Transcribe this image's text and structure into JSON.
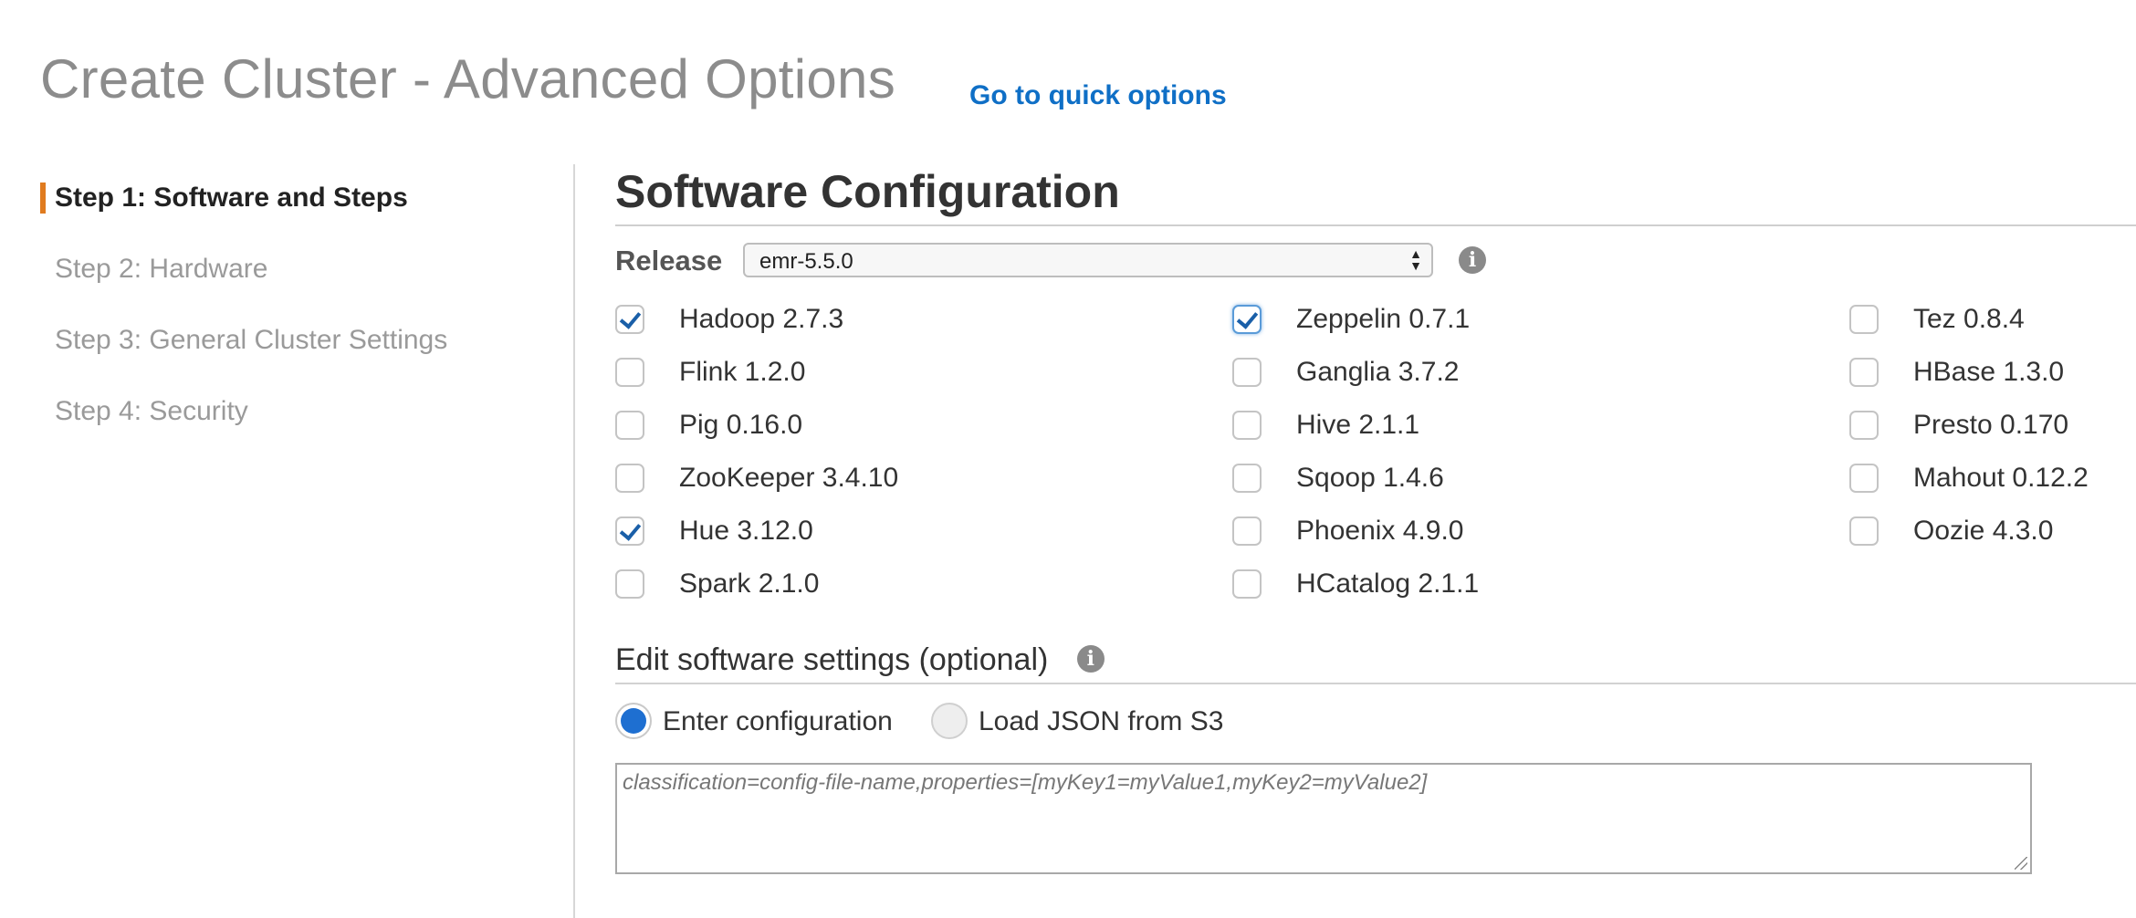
{
  "page": {
    "title": "Create Cluster - Advanced Options",
    "quick_options_link": "Go to quick options"
  },
  "sidebar": {
    "items": [
      {
        "label": "Step 1: Software and Steps",
        "active": true
      },
      {
        "label": "Step 2: Hardware",
        "active": false
      },
      {
        "label": "Step 3: General Cluster Settings",
        "active": false
      },
      {
        "label": "Step 4: Security",
        "active": false
      }
    ]
  },
  "software": {
    "title": "Software Configuration",
    "release_label": "Release",
    "release_value": "emr-5.5.0",
    "info_icon": "info-icon",
    "applications": [
      {
        "label": "Hadoop 2.7.3",
        "checked": true
      },
      {
        "label": "Flink 1.2.0",
        "checked": false
      },
      {
        "label": "Pig 0.16.0",
        "checked": false
      },
      {
        "label": "ZooKeeper 3.4.10",
        "checked": false
      },
      {
        "label": "Hue 3.12.0",
        "checked": true
      },
      {
        "label": "Spark 2.1.0",
        "checked": false
      },
      {
        "label": "Zeppelin 0.7.1",
        "checked": true
      },
      {
        "label": "Ganglia 3.7.2",
        "checked": false
      },
      {
        "label": "Hive 2.1.1",
        "checked": false
      },
      {
        "label": "Sqoop 1.4.6",
        "checked": false
      },
      {
        "label": "Phoenix 4.9.0",
        "checked": false
      },
      {
        "label": "HCatalog 2.1.1",
        "checked": false
      },
      {
        "label": "Tez 0.8.4",
        "checked": false
      },
      {
        "label": "HBase 1.3.0",
        "checked": false
      },
      {
        "label": "Presto 0.170",
        "checked": false
      },
      {
        "label": "Mahout 0.12.2",
        "checked": false
      },
      {
        "label": "Oozie 4.3.0",
        "checked": false
      }
    ]
  },
  "edit_settings": {
    "title": "Edit software settings (optional)",
    "options": [
      {
        "label": "Enter configuration",
        "selected": true
      },
      {
        "label": "Load JSON from S3",
        "selected": false
      }
    ],
    "config_placeholder": "classification=config-file-name,properties=[myKey1=myValue1,myKey2=myValue2]"
  },
  "colors": {
    "accent": "#e07b1f",
    "link": "#0f6fc6",
    "check": "#1a5fa8",
    "radio_selected": "#1e6fd1"
  }
}
